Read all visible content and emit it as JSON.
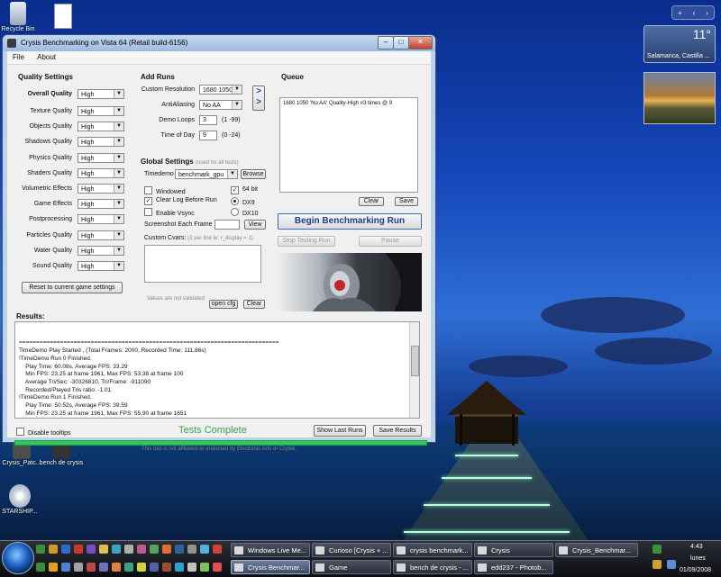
{
  "desktop": {
    "icons": [
      {
        "label": "Recycle Bin"
      },
      {
        "label": ""
      },
      {
        "label": "Crysis_Patc..."
      },
      {
        "label": "bench de crysis"
      },
      {
        "label": "STARSHIP..."
      }
    ],
    "weather": {
      "temp": "11°",
      "city": "Salamanca, Castilla ..."
    }
  },
  "window": {
    "title": "Crysis Benchmarking on Vista 64 (Retail build-6156)",
    "menu": [
      "File",
      "About"
    ],
    "quality": {
      "heading": "Quality Settings",
      "overall_label": "Overall Quality",
      "overall_value": "High",
      "rows": [
        {
          "label": "Texture Quality",
          "value": "High"
        },
        {
          "label": "Objects Quality",
          "value": "High"
        },
        {
          "label": "Shadows Quality",
          "value": "High"
        },
        {
          "label": "Physics Quality",
          "value": "High"
        },
        {
          "label": "Shaders Quality",
          "value": "High"
        },
        {
          "label": "Volumetric Effects",
          "value": "High"
        },
        {
          "label": "Game Effects",
          "value": "High"
        },
        {
          "label": "Postprocessing",
          "value": "High"
        },
        {
          "label": "Particles Quality",
          "value": "High"
        },
        {
          "label": "Water Quality",
          "value": "High"
        },
        {
          "label": "Sound Quality",
          "value": "High"
        }
      ],
      "reset_button": "Reset to current game settings"
    },
    "add_runs": {
      "heading": "Add Runs",
      "resolution_label": "Custom Resolution",
      "resolution_value": "1680 1050",
      "aa_label": "AntiAliasing",
      "aa_value": "No AA",
      "loops_label": "Demo Loops",
      "loops_value": "3",
      "loops_range": "(1 -99)",
      "tod_label": "Time of Day",
      "tod_value": "9",
      "tod_range": "(0 -24)",
      "arrow": ">"
    },
    "queue": {
      "heading": "Queue",
      "item": "1680 1050 'No AA' Quality-High #3 times @ 9",
      "clear": "Clear",
      "save": "Save"
    },
    "global": {
      "heading": "Global Settings",
      "note": "(used for all tests)",
      "timedemo_label": "Timedemo",
      "timedemo_value": "benchmark_gpu",
      "browse": "Browse",
      "windowed": "Windowed",
      "clear_log": "Clear Log Before Run",
      "vsync": "Enable Vsync",
      "bit64": "64 bit",
      "dx9": "DX9",
      "dx10": "DX10",
      "screenshot_label": "Screenshot Each Frame",
      "view": "View",
      "cvars_label": "Custom Cvars:",
      "cvars_hint": "(1 per line ie: r_display = 1)",
      "validated": "Values are not validated",
      "open_cfg": "open cfg",
      "clear": "Clear"
    },
    "actions": {
      "begin": "Begin Benchmarking Run",
      "stop": "Stop Testing Run",
      "pause": "Pause"
    },
    "results": {
      "heading": "Results:",
      "lines": [
        "============================================================================",
        "TimeDemo Play Started , (Total Frames: 2000, Recorded Time: 111.86s)",
        "!TimeDemo Run 0 Finished.",
        "    Play Time: 60.08s, Average FPS: 33.29",
        "    Min FPS: 23.25 at frame 1961, Max FPS: 53.38 at frame 100",
        "    Average Tri/Sec: -30326810, Tri/Frame: -911090",
        "    Recorded/Played Tris ratio: -1.01",
        "!TimeDemo Run 1 Finished.",
        "    Play Time: 50.52s, Average FPS: 39.59",
        "    Min FPS: 23.25 at frame 1961, Max FPS: 55.90 at frame 1651",
        "    Average Tri/Sec: -35704344, Tri/Frame: -901945",
        "    Recorded/Played Tris ratio: -1.02",
        "!TimeDemo Run 2 Finished."
      ]
    },
    "footer": {
      "disable_tooltips": "Disable tooltips",
      "status": "Tests Complete",
      "show_last": "Show Last Runs",
      "save_results": "Save Results",
      "progress": 1.0,
      "disclaimer": "This tool is not affiliated or endorsed by Electronic Arts or Crytek."
    }
  },
  "taskbar": {
    "top_row": [
      "Windows Live Me...",
      "Curioso [Crysis + ...",
      "crysis benchmark...",
      "Crysis",
      "Crysis_Benchmar..."
    ],
    "bottom_row": [
      "Crysis Benchmar...",
      "Game",
      "bench de crysis - ...",
      "edd237 - Photob..."
    ],
    "time": "4:43",
    "day": "lunes",
    "date": "01/09/2008"
  }
}
